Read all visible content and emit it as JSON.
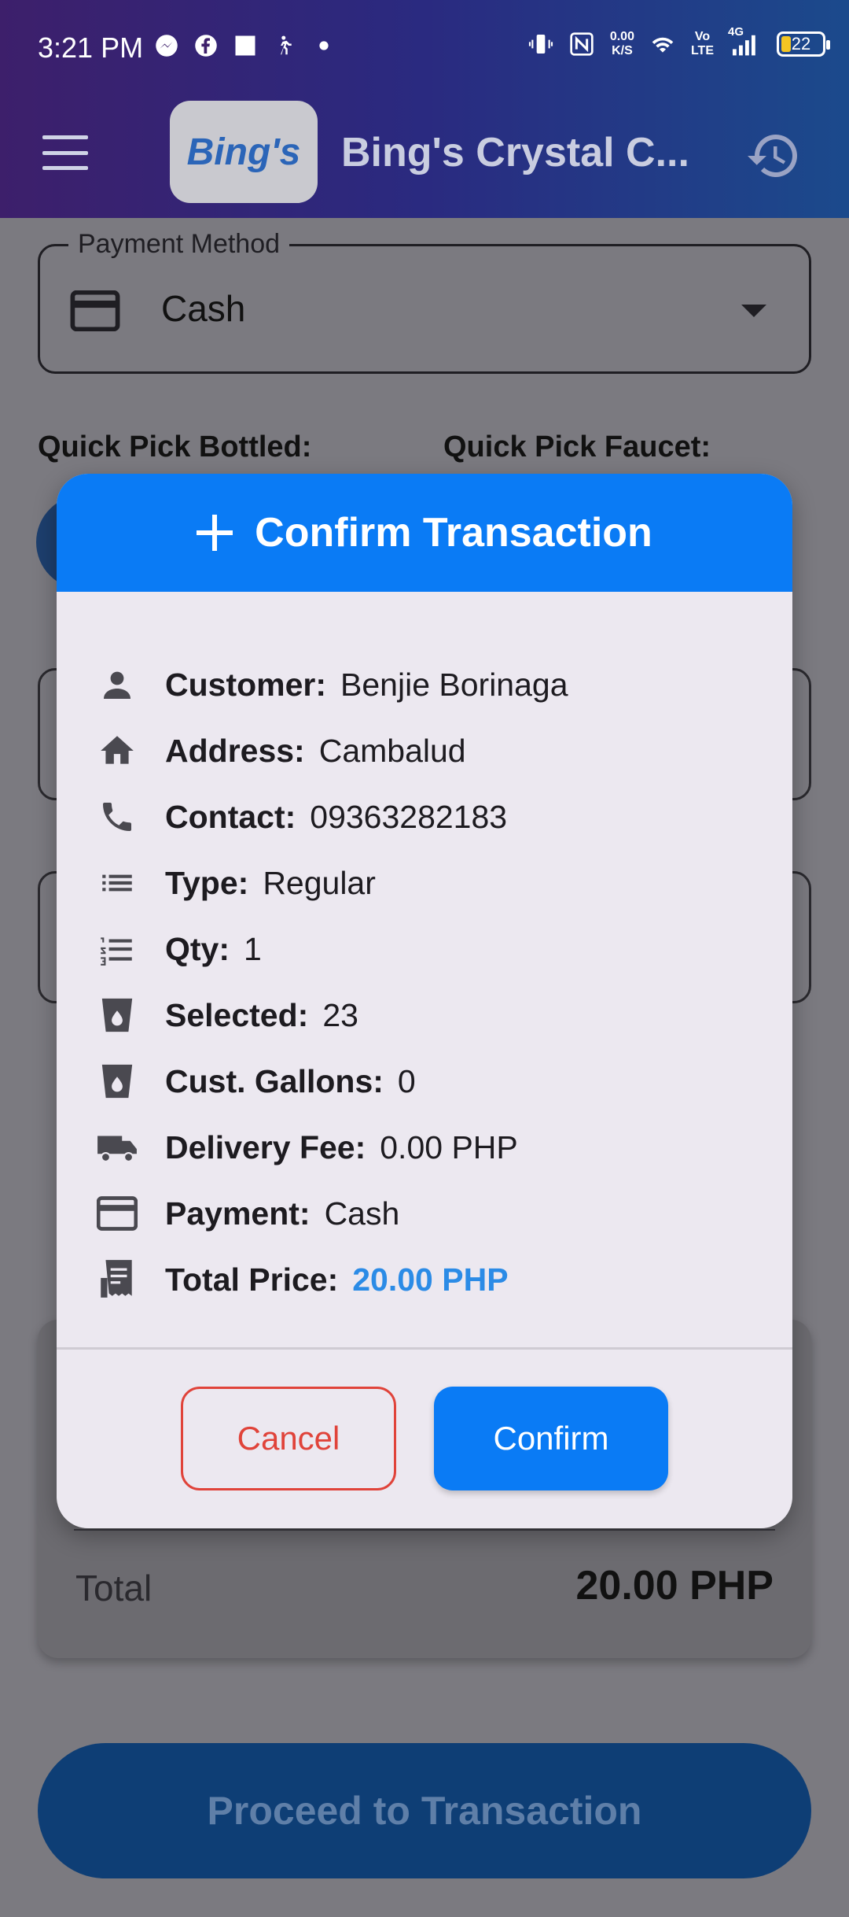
{
  "status_bar": {
    "time": "3:21 PM",
    "net_speed_value": "0.00",
    "net_speed_unit": "K/S",
    "volte_line1": "Vo",
    "volte_line2": "LTE",
    "signal_label": "4G",
    "battery": "22"
  },
  "app_bar": {
    "logo_text": "Bing's",
    "title": "Bing's Crystal C..."
  },
  "form": {
    "payment_method_label": "Payment Method",
    "payment_method_value": "Cash",
    "quick_pick_bottled": "Quick Pick Bottled:",
    "quick_pick_faucet": "Quick Pick Faucet:"
  },
  "summary": {
    "total_label": "Total",
    "total_value": "20.00 PHP"
  },
  "proceed_button": "Proceed to Transaction",
  "dialog": {
    "title": "Confirm Transaction",
    "rows": [
      {
        "label": "Customer:",
        "value": "Benjie Borinaga",
        "icon": "person-icon"
      },
      {
        "label": "Address:",
        "value": "Cambalud",
        "icon": "home-icon"
      },
      {
        "label": "Contact:",
        "value": "09363282183",
        "icon": "phone-icon"
      },
      {
        "label": "Type:",
        "value": "Regular",
        "icon": "list-icon"
      },
      {
        "label": "Qty:",
        "value": "1",
        "icon": "numbered-list-icon"
      },
      {
        "label": "Selected:",
        "value": "23",
        "icon": "water-cup-icon"
      },
      {
        "label": "Cust. Gallons:",
        "value": "0",
        "icon": "water-cup-icon"
      },
      {
        "label": "Delivery Fee:",
        "value": "0.00 PHP",
        "icon": "truck-icon"
      },
      {
        "label": "Payment:",
        "value": "Cash",
        "icon": "credit-card-icon"
      },
      {
        "label": "Total Price:",
        "value": "20.00 PHP",
        "icon": "receipt-icon"
      }
    ],
    "cancel_label": "Cancel",
    "confirm_label": "Confirm"
  },
  "colors": {
    "accent": "#0a7bf5",
    "cancel": "#e0433a",
    "price": "#2b8be6"
  }
}
